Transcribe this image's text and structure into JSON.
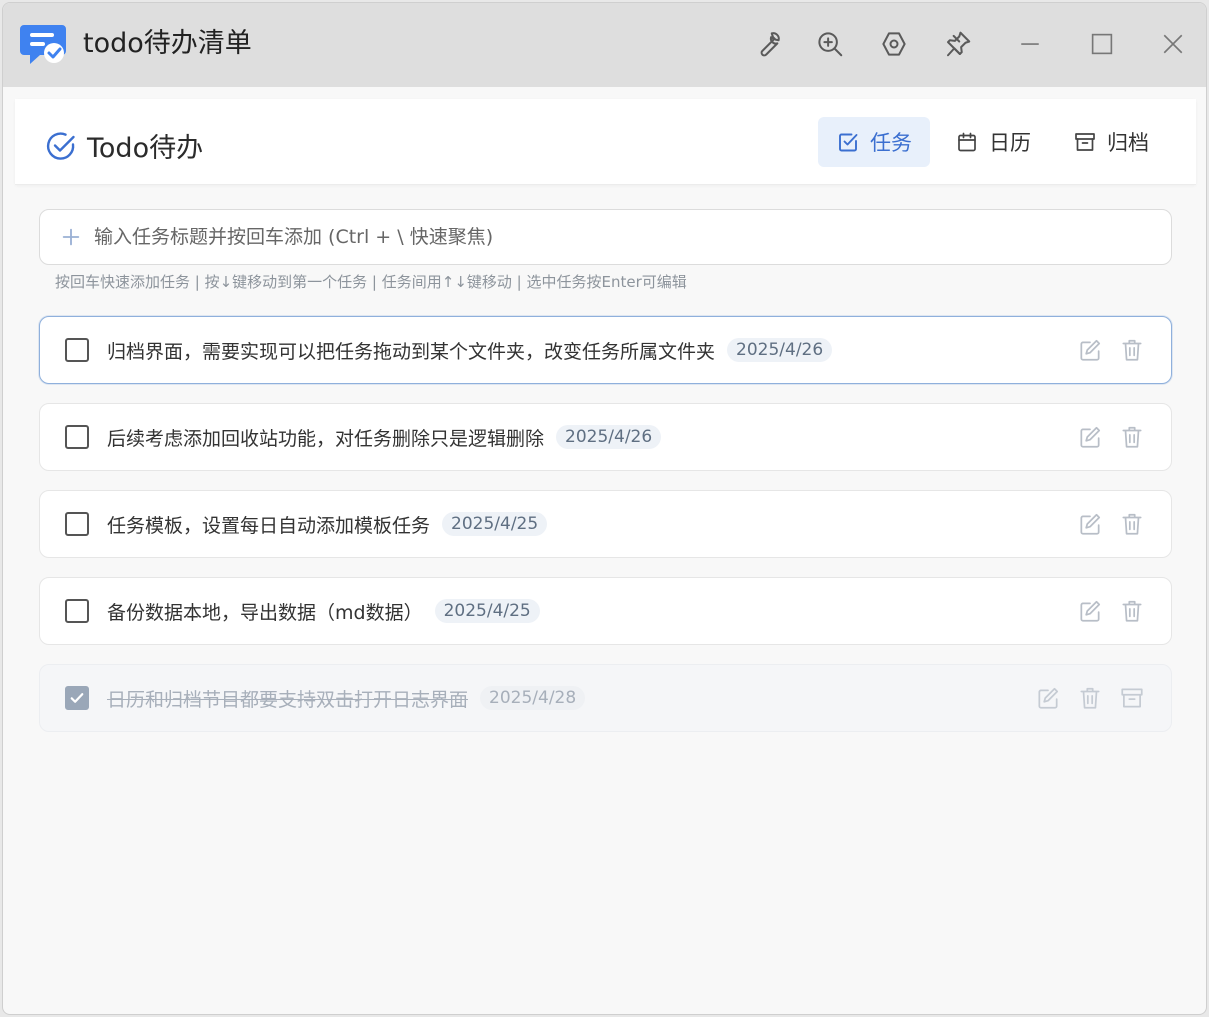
{
  "window": {
    "title": "todo待办清单",
    "controls": [
      "wrench-icon",
      "zoom-in-icon",
      "settings-hex-icon",
      "pin-icon",
      "minimize-icon",
      "maximize-icon",
      "close-icon"
    ]
  },
  "header": {
    "brand": "Todo待办",
    "tabs": [
      {
        "label": "任务",
        "icon": "checkbox-icon",
        "active": true
      },
      {
        "label": "日历",
        "icon": "calendar-icon",
        "active": false
      },
      {
        "label": "归档",
        "icon": "archive-icon",
        "active": false
      }
    ]
  },
  "add_task": {
    "placeholder": "输入任务标题并按回车添加 (Ctrl + \\ 快速聚焦)",
    "value": "",
    "hint": "按回车快速添加任务 | 按↓键移动到第一个任务 | 任务间用↑↓键移动 | 选中任务按Enter可编辑"
  },
  "tasks": [
    {
      "title": "归档界面，需要实现可以把任务拖动到某个文件夹，改变任务所属文件夹",
      "date": "2025/4/26",
      "done": false,
      "focused": true
    },
    {
      "title": "后续考虑添加回收站功能，对任务删除只是逻辑删除",
      "date": "2025/4/26",
      "done": false,
      "focused": false
    },
    {
      "title": "任务模板，设置每日自动添加模板任务",
      "date": "2025/4/25",
      "done": false,
      "focused": false
    },
    {
      "title": "备份数据本地，导出数据（md数据）",
      "date": "2025/4/25",
      "done": false,
      "focused": false
    },
    {
      "title": "日历和归档节目都要支持双击打开日志界面",
      "date": "2025/4/28",
      "done": true,
      "focused": false
    }
  ],
  "colors": {
    "accent": "#3b6fd0",
    "logo_blue": "#3f82f0",
    "icon_gray": "#5a5a5a",
    "muted_icon": "#b8bec7"
  }
}
